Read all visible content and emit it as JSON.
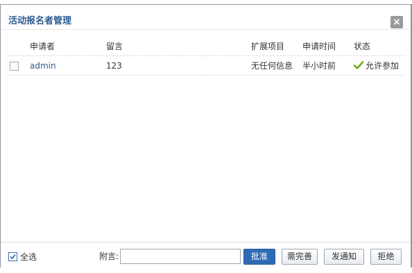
{
  "dialog": {
    "title": "活动报名者管理",
    "close_symbol": "×"
  },
  "table": {
    "headers": {
      "applicant": "申请者",
      "message": "留言",
      "extra": "扩展项目",
      "time": "申请时间",
      "status": "状态"
    },
    "rows": [
      {
        "applicant": "admin",
        "message": "123",
        "extra": "无任何信息",
        "time": "半小时前",
        "status": "允许参加"
      }
    ]
  },
  "footer": {
    "select_all_label": "全选",
    "select_all_checked": true,
    "note_label": "附言:",
    "note_value": "",
    "buttons": {
      "approve": "批准",
      "improve": "需完善",
      "notify": "发通知",
      "reject": "拒绝"
    }
  },
  "colors": {
    "title": "#2d5b91",
    "primary_button": "#2e6bb4",
    "status_check": "#6aab1e"
  }
}
